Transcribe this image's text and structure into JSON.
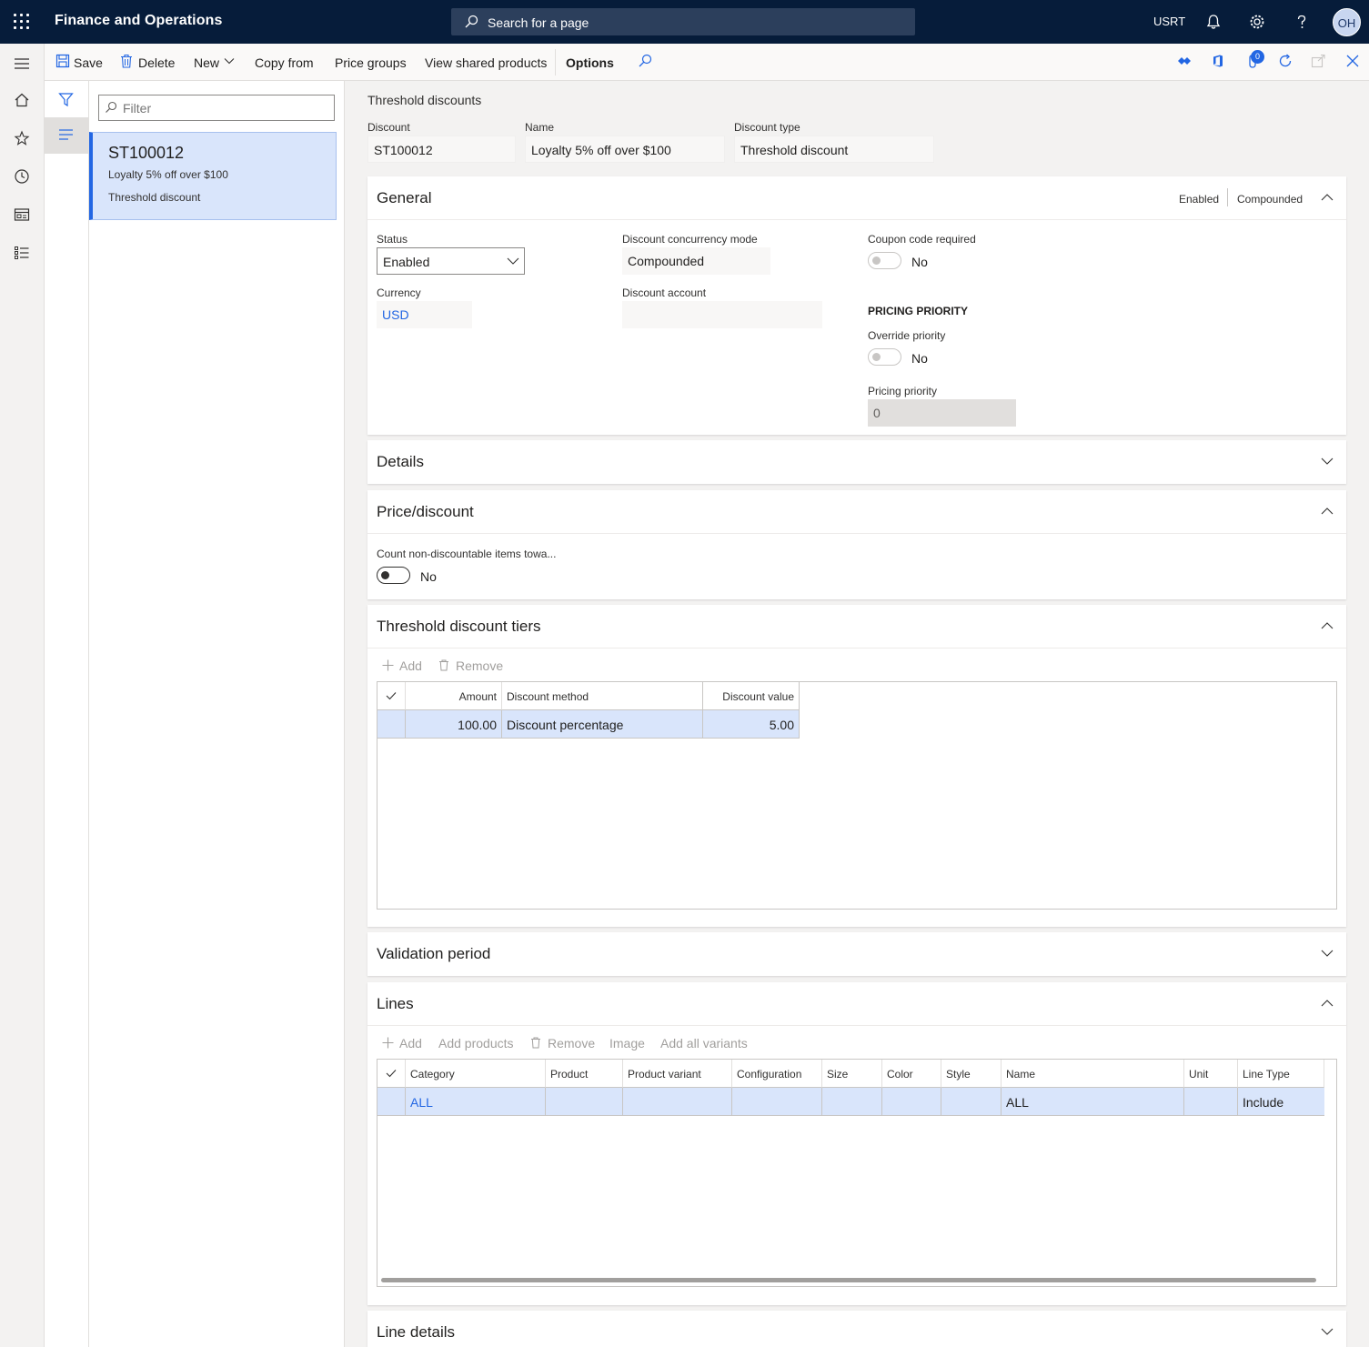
{
  "topbar": {
    "app_title": "Finance and Operations",
    "search_placeholder": "Search for a page",
    "company": "USRT",
    "user_initials": "OH"
  },
  "actionbar": {
    "save": "Save",
    "delete": "Delete",
    "new": "New",
    "copy_from": "Copy from",
    "price_groups": "Price groups",
    "view_shared_products": "View shared products",
    "options": "Options",
    "badge_count": "0"
  },
  "list": {
    "filter_placeholder": "Filter",
    "items": [
      {
        "id": "ST100012",
        "name": "Loyalty 5% off over $100",
        "type": "Threshold discount"
      }
    ]
  },
  "header": {
    "caption": "Threshold discounts",
    "discount_label": "Discount",
    "discount_value": "ST100012",
    "name_label": "Name",
    "name_value": "Loyalty 5% off over $100",
    "type_label": "Discount type",
    "type_value": "Threshold discount"
  },
  "general": {
    "title": "General",
    "summary_status": "Enabled",
    "summary_mode": "Compounded",
    "status_label": "Status",
    "status_value": "Enabled",
    "currency_label": "Currency",
    "currency_value": "USD",
    "concurrency_label": "Discount concurrency mode",
    "concurrency_value": "Compounded",
    "account_label": "Discount account",
    "account_value": "",
    "coupon_label": "Coupon code required",
    "coupon_value": "No",
    "pricing_priority_heading": "PRICING PRIORITY",
    "override_label": "Override priority",
    "override_value": "No",
    "priority_label": "Pricing priority",
    "priority_value": "0"
  },
  "details": {
    "title": "Details"
  },
  "price_discount": {
    "title": "Price/discount",
    "count_label": "Count non-discountable items towa...",
    "count_value": "No"
  },
  "tiers": {
    "title": "Threshold discount tiers",
    "add": "Add",
    "remove": "Remove",
    "columns": {
      "amount": "Amount",
      "method": "Discount method",
      "value": "Discount value"
    },
    "rows": [
      {
        "amount": "100.00",
        "method": "Discount percentage",
        "value": "5.00"
      }
    ]
  },
  "validation": {
    "title": "Validation period"
  },
  "lines": {
    "title": "Lines",
    "add": "Add",
    "add_products": "Add products",
    "remove": "Remove",
    "image": "Image",
    "add_all_variants": "Add all variants",
    "columns": {
      "category": "Category",
      "product": "Product",
      "product_variant": "Product variant",
      "configuration": "Configuration",
      "size": "Size",
      "color": "Color",
      "style": "Style",
      "name": "Name",
      "unit": "Unit",
      "line_type": "Line Type"
    },
    "rows": [
      {
        "category": "ALL",
        "name": "ALL",
        "line_type": "Include"
      }
    ]
  },
  "line_details": {
    "title": "Line details"
  },
  "colors": {
    "topbar": "#061c3a",
    "accent": "#2266e3",
    "selected_row": "#d9e5fb"
  }
}
